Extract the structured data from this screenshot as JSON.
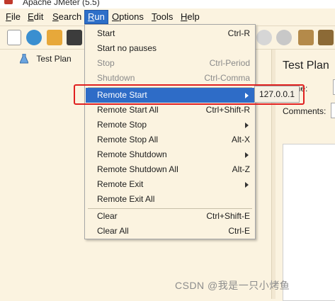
{
  "window": {
    "title": "Apache JMeter (5.5)"
  },
  "menubar": {
    "items": [
      {
        "key": "F",
        "rest": "ile"
      },
      {
        "key": "E",
        "rest": "dit"
      },
      {
        "key": "S",
        "rest": "earch"
      },
      {
        "key": "R",
        "rest": "un"
      },
      {
        "key": "O",
        "rest": "ptions"
      },
      {
        "key": "T",
        "rest": "ools"
      },
      {
        "key": "H",
        "rest": "elp"
      }
    ]
  },
  "toolbar": {
    "icons": [
      "new-file-icon",
      "templates-icon",
      "open-icon",
      "save-icon",
      "stop-icon",
      "shutdown-icon",
      "clear-icon",
      "clear-all-icon"
    ]
  },
  "tree": {
    "root_label": "Test Plan"
  },
  "right_pane": {
    "title": "Test Plan",
    "name_label": "Name:",
    "comments_label": "Comments:"
  },
  "run_menu": {
    "items": [
      {
        "label": "Start",
        "accel": "Ctrl-R"
      },
      {
        "label": "Start no pauses",
        "accel": ""
      },
      {
        "label": "Stop",
        "accel": "Ctrl-Period"
      },
      {
        "label": "Shutdown",
        "accel": "Ctrl-Comma"
      },
      {
        "label": "Remote Start",
        "accel": ""
      },
      {
        "label": "Remote Start All",
        "accel": "Ctrl+Shift-R"
      },
      {
        "label": "Remote Stop",
        "accel": ""
      },
      {
        "label": "Remote Stop All",
        "accel": "Alt-X"
      },
      {
        "label": "Remote Shutdown",
        "accel": ""
      },
      {
        "label": "Remote Shutdown All",
        "accel": "Alt-Z"
      },
      {
        "label": "Remote Exit",
        "accel": ""
      },
      {
        "label": "Remote Exit All",
        "accel": ""
      },
      {
        "label": "Clear",
        "accel": "Ctrl+Shift-E"
      },
      {
        "label": "Clear All",
        "accel": "Ctrl-E"
      }
    ],
    "submenu_item": "127.0.0.1"
  },
  "watermark": "CSDN @我是一只小烤鱼",
  "colors": {
    "selection": "#2e6cc7",
    "highlight_border": "#e02020",
    "background": "#fbf3e0"
  }
}
